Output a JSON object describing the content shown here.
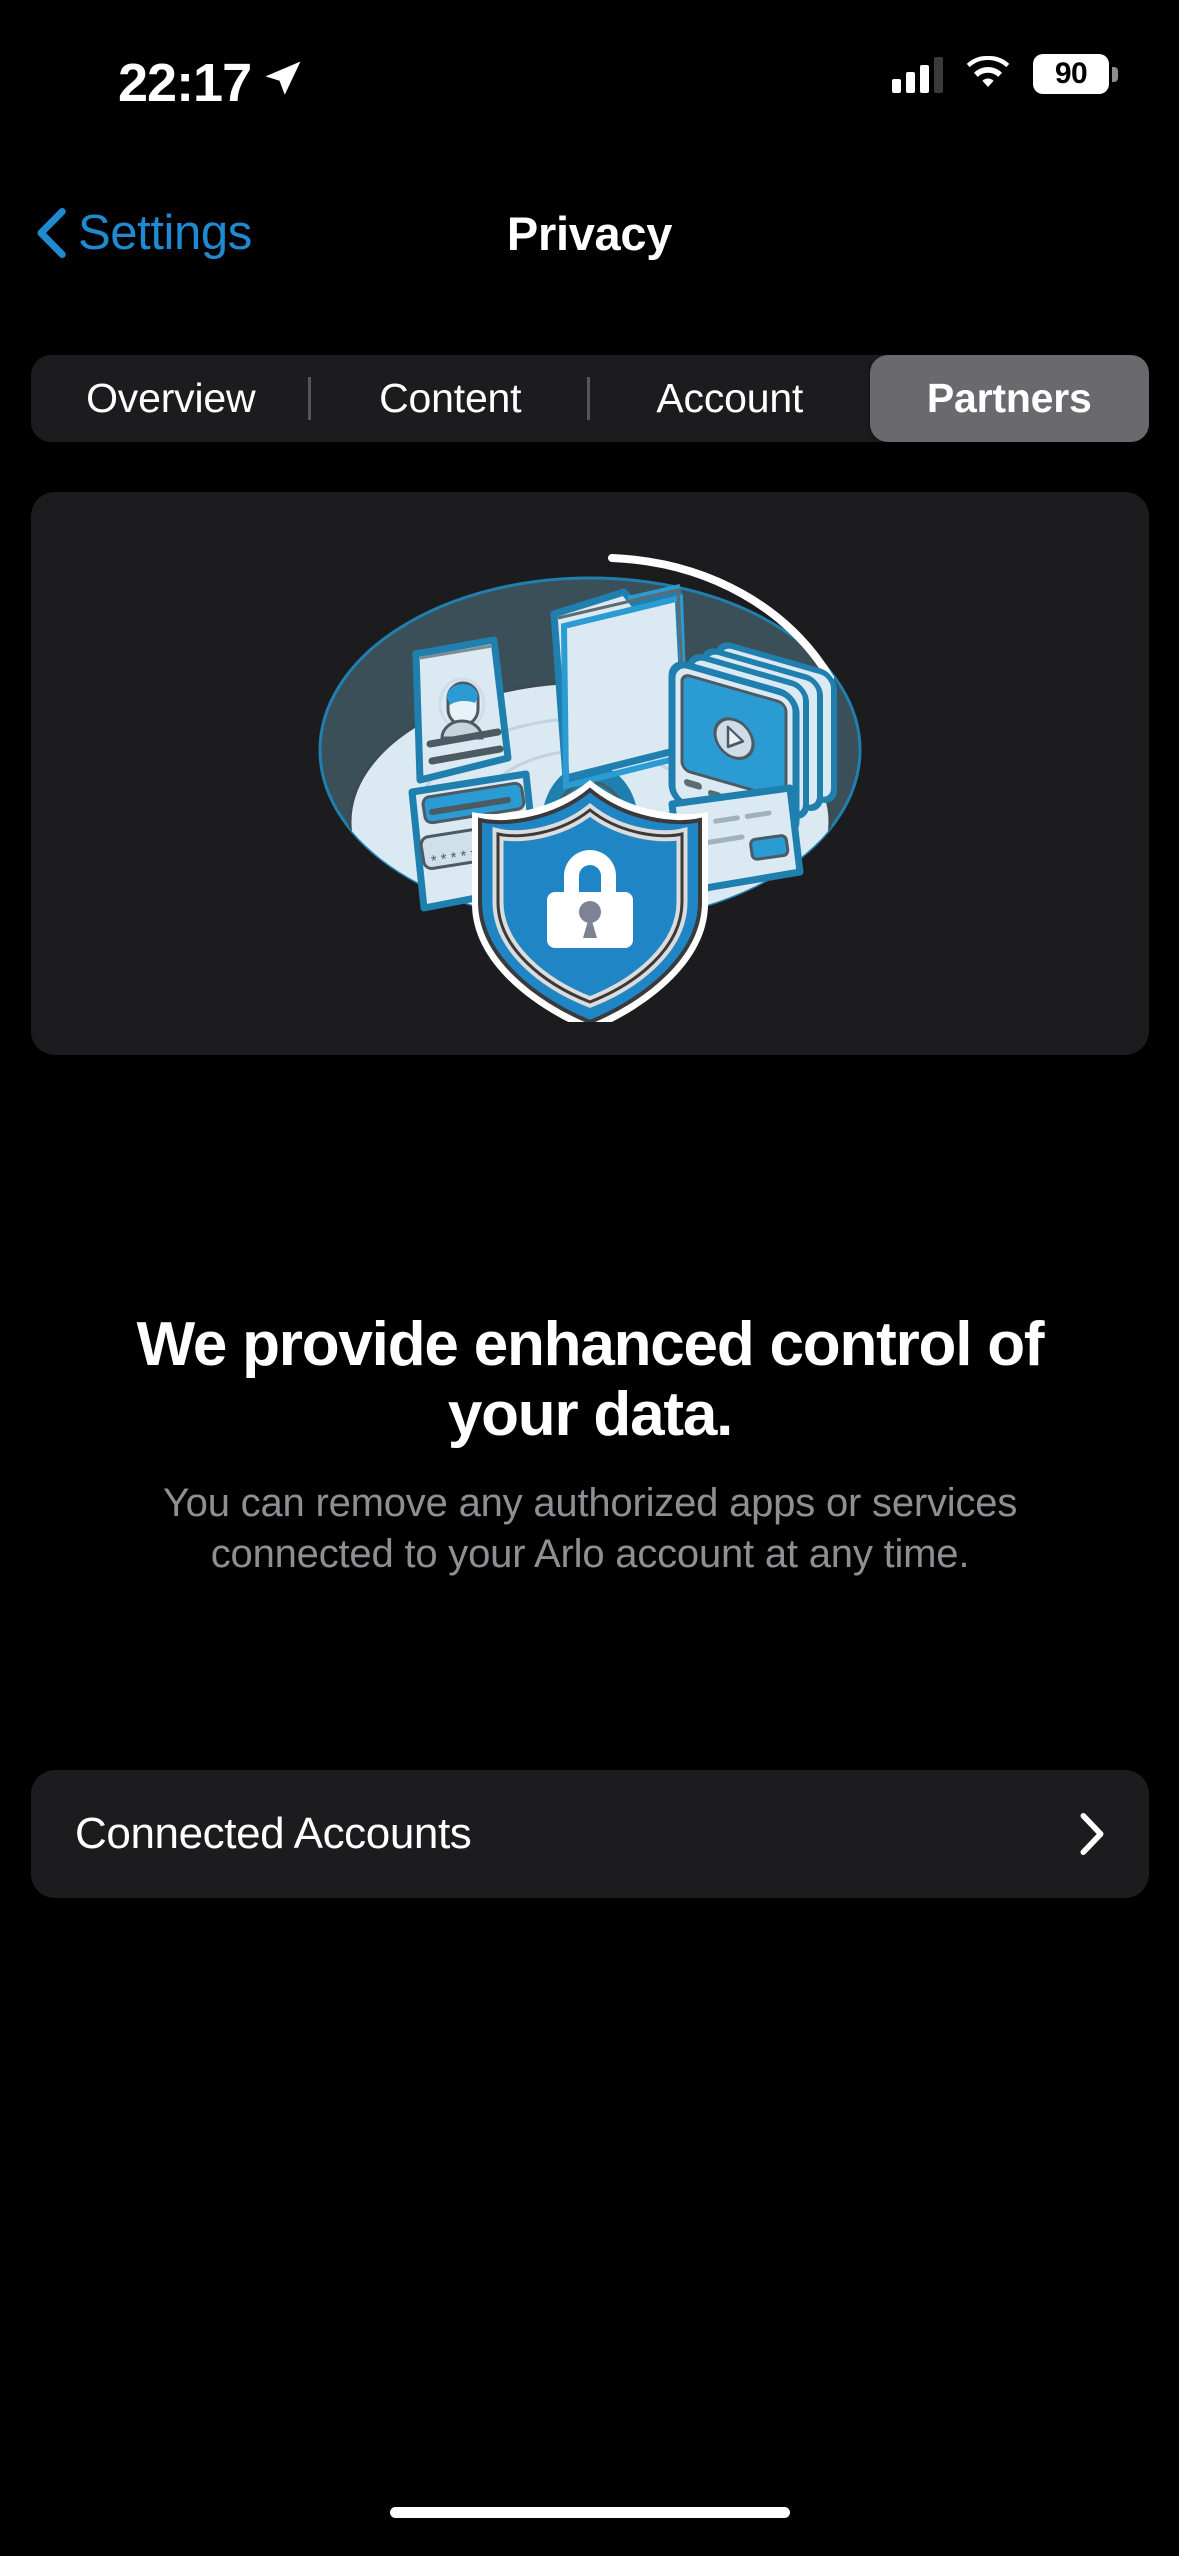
{
  "status_bar": {
    "time": "22:17",
    "location_icon": "location-arrow-icon",
    "cellular_icon": "cellular-bars-icon",
    "wifi_icon": "wifi-icon",
    "battery_level": "90",
    "battery_icon": "battery-icon"
  },
  "nav": {
    "back_label": "Settings",
    "back_icon": "chevron-left-icon",
    "title": "Privacy"
  },
  "segmented_control": {
    "selected": "Partners",
    "tabs": [
      {
        "label": "Overview",
        "selected": false
      },
      {
        "label": "Content",
        "selected": false
      },
      {
        "label": "Account",
        "selected": false
      },
      {
        "label": "Partners",
        "selected": true
      }
    ]
  },
  "hero": {
    "illustration_name": "privacy-shield-illustration",
    "headline": "We provide enhanced control of your data.",
    "body": "You can remove any authorized apps or services connected to your Arlo account at any time."
  },
  "list": {
    "rows": [
      {
        "label": "Connected Accounts",
        "chevron": "chevron-right-icon"
      }
    ]
  },
  "colors": {
    "background": "#000000",
    "card": "#1c1c1e",
    "accent_blue": "#1f8ad0",
    "selected_segment": "#6a6a6e",
    "secondary_text": "#8e8e93",
    "illustration_shield": "#1f85c4",
    "illustration_dark_teal": "#3b4f59",
    "illustration_light": "#d8e7f0"
  }
}
